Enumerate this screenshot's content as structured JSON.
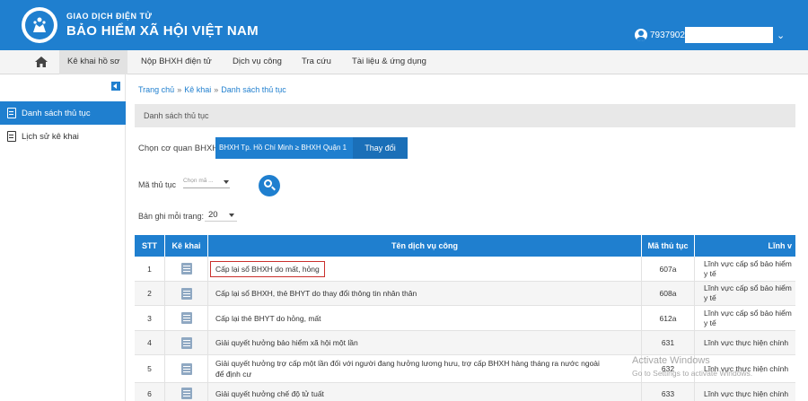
{
  "header": {
    "brand_line1": "GIAO DỊCH ĐIỆN TỬ",
    "brand_line2": "BẢO HIỂM XÃ HỘI VIỆT NAM",
    "user_id": "7937902",
    "brand_color": "#1f7fcf"
  },
  "nav": {
    "items": [
      "Kê khai hồ sơ",
      "Nộp BHXH điện tử",
      "Dịch vụ công",
      "Tra cứu",
      "Tài liệu & ứng dụng"
    ],
    "active": "Kê khai hồ sơ"
  },
  "sidebar": {
    "items": [
      "Danh sách thủ tục",
      "Lịch sử kê khai"
    ],
    "active": "Danh sách thủ tục"
  },
  "breadcrumb": [
    "Trang chủ",
    "Kê khai",
    "Danh sách thủ tục"
  ],
  "section_title": "Danh sách thủ tục",
  "agency": {
    "label": "Chọn cơ quan BHXH:",
    "value": "BHXH Tp. Hồ Chí Minh ≥ BHXH Quận 1",
    "button": "Thay đổi"
  },
  "code_filter": {
    "label": "Mã thủ tục",
    "placeholder": "Chọn mã ..."
  },
  "per_page": {
    "label": "Bản ghi mỗi trang:",
    "value": "20"
  },
  "table": {
    "headers": [
      "STT",
      "Kê khai",
      "Tên dịch vụ công",
      "Mã thủ tục",
      "Lĩnh v"
    ],
    "rows": [
      {
        "stt": "1",
        "name": "Cấp lại sổ BHXH do mất, hỏng",
        "code": "607a",
        "field": "Lĩnh vực cấp sổ bảo hiểm",
        "field2": "y tế"
      },
      {
        "stt": "2",
        "name": "Cấp lại sổ BHXH, thẻ BHYT do thay đổi thông tin nhân thân",
        "code": "608a",
        "field": "Lĩnh vực cấp sổ bảo hiểm",
        "field2": "y tế"
      },
      {
        "stt": "3",
        "name": "Cấp lại thẻ BHYT do hỏng, mất",
        "code": "612a",
        "field": "Lĩnh vực cấp sổ bảo hiểm",
        "field2": "y tế"
      },
      {
        "stt": "4",
        "name": "Giải quyết hưởng bảo hiểm xã hội một lần",
        "code": "631",
        "field": "Lĩnh vực thực hiện chính",
        "field2": ""
      },
      {
        "stt": "5",
        "name": "Giải quyết hưởng trợ cấp một lần đối với người đang hưởng lương hưu, trợ cấp BHXH hàng tháng ra nước ngoài",
        "name2": "để định cư",
        "code": "632",
        "field": "Lĩnh vực thực hiện chính",
        "field2": ""
      },
      {
        "stt": "6",
        "name": "Giải quyết hưởng chế độ tử tuất",
        "code": "633",
        "field": "Lĩnh vực thực hiện chính",
        "field2": ""
      }
    ]
  },
  "watermark": {
    "title": "Activate Windows",
    "subtitle": "Go to Settings to activate Windows."
  }
}
